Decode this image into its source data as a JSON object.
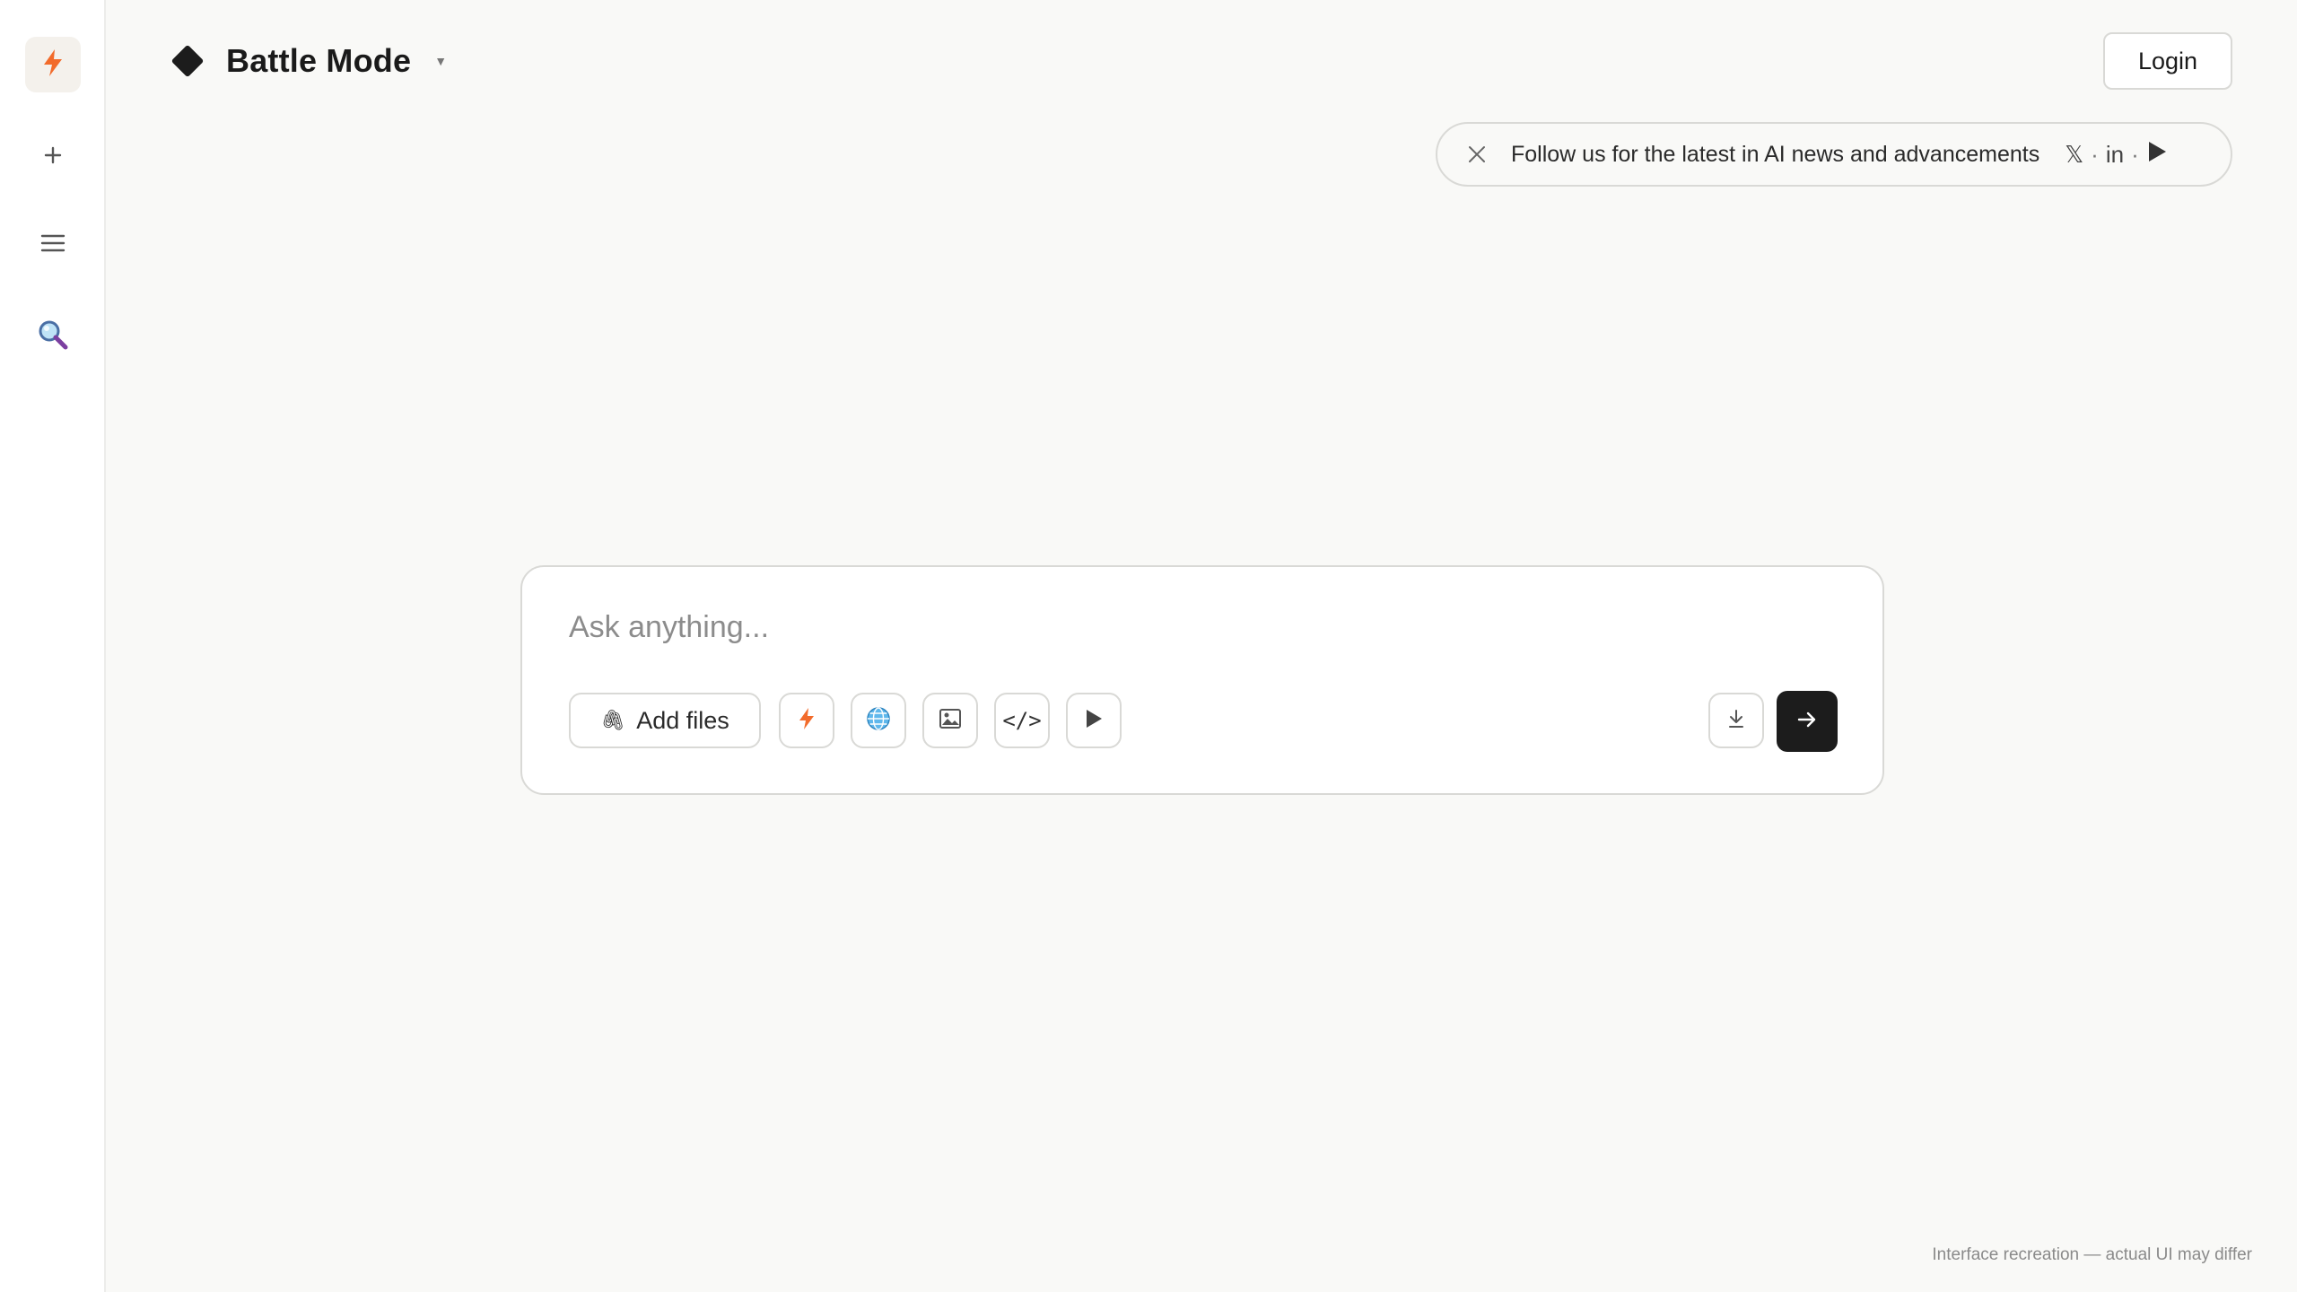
{
  "sidebar": {
    "logo_icon": "bolt-icon",
    "new_icon": "plus-icon",
    "menu_icon": "hamburger-menu-icon",
    "search_icon": "magnifier-icon"
  },
  "header": {
    "mode_title": "Battle Mode",
    "mode_icon": "diamond-icon",
    "dropdown_icon": "caret-down-icon",
    "caret_glyph": "▼",
    "login_label": "Login"
  },
  "banner": {
    "text": "Follow us for the latest in AI news and advancements",
    "x_label": "𝕏",
    "separator": "·",
    "linkedin_label": "in",
    "close_icon": "close-icon",
    "youtube_icon": "play-triangle-icon"
  },
  "composer": {
    "placeholder": "Ask anything...",
    "value": "",
    "add_files_label": "Add files",
    "clip_glyph": "🖇",
    "code_label": "</>",
    "tools": [
      "bolt-icon",
      "globe-icon",
      "image-icon",
      "code-icon",
      "play-icon"
    ],
    "download_icon": "download-icon",
    "send_icon": "arrow-right-icon"
  },
  "footer": {
    "disclaimer": "Interface recreation — actual UI may differ"
  },
  "colors": {
    "background": "#f9f9f7",
    "sidebar": "#ffffff",
    "accent_bolt": "#f26b2b",
    "send_button": "#1c1c1c",
    "border": "#d9d9d6"
  }
}
